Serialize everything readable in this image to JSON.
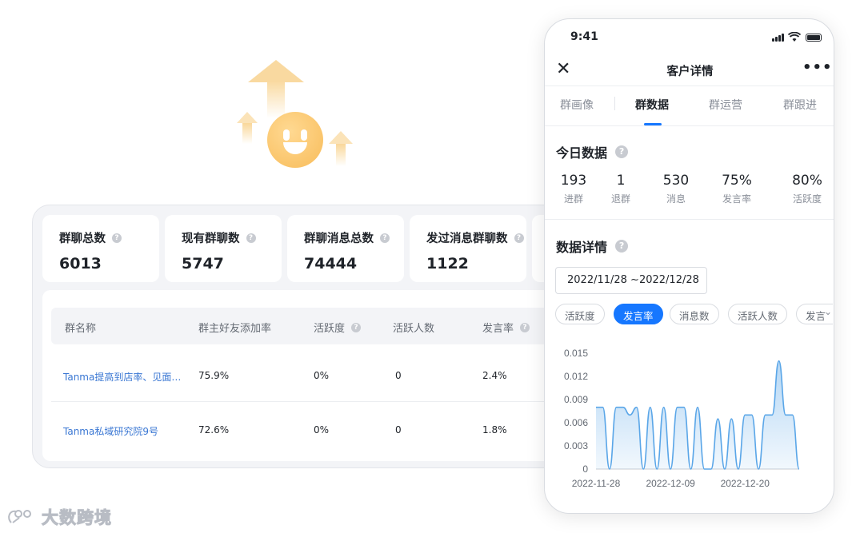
{
  "dashboard": {
    "stats": [
      {
        "label": "群聊总数",
        "value": "6013"
      },
      {
        "label": "现有群聊数",
        "value": "5747"
      },
      {
        "label": "群聊消息总数",
        "value": "74444"
      },
      {
        "label": "发过消息群聊数",
        "value": "1122"
      }
    ],
    "table": {
      "headers": [
        "群名称",
        "群主好友添加率",
        "活跃度",
        "活跃人数",
        "发言率"
      ],
      "rows": [
        [
          "Tanma提高到店率、见面…",
          "75.9%",
          "0%",
          "0",
          "2.4%"
        ],
        [
          "Tanma私域研究院9号",
          "72.6%",
          "0%",
          "0",
          "1.8%"
        ]
      ]
    }
  },
  "phone": {
    "status_time": "9:41",
    "title": "客户详情",
    "tabs": [
      "群画像",
      "群数据",
      "群运营",
      "群跟进"
    ],
    "active_tab": 1,
    "today_title": "今日数据",
    "kpis": [
      {
        "value": "193",
        "label": "进群"
      },
      {
        "value": "1",
        "label": "退群"
      },
      {
        "value": "530",
        "label": "消息"
      },
      {
        "value": "75%",
        "label": "发言率"
      },
      {
        "value": "80%",
        "label": "活跃度"
      }
    ],
    "detail_title": "数据详情",
    "date_range": "2022/11/28  ~2022/12/28",
    "chips": [
      "活跃度",
      "发言率",
      "消息数",
      "活跃人数",
      "发言"
    ],
    "active_chip": 1
  },
  "chart_data": {
    "type": "area",
    "y_ticks": [
      "0.015",
      "0.012",
      "0.009",
      "0.006",
      "0.003",
      "0"
    ],
    "ylim": [
      0,
      0.015
    ],
    "x_ticks": [
      "2022-11-28",
      "2022-12-09",
      "2022-12-20"
    ],
    "x": [
      "2022-11-28",
      "2022-11-29",
      "2022-11-30",
      "2022-12-01",
      "2022-12-02",
      "2022-12-03",
      "2022-12-04",
      "2022-12-05",
      "2022-12-06",
      "2022-12-07",
      "2022-12-08",
      "2022-12-09",
      "2022-12-10",
      "2022-12-11",
      "2022-12-12",
      "2022-12-13",
      "2022-12-14",
      "2022-12-15",
      "2022-12-16",
      "2022-12-17",
      "2022-12-18",
      "2022-12-19",
      "2022-12-20",
      "2022-12-21",
      "2022-12-22",
      "2022-12-23",
      "2022-12-24",
      "2022-12-25",
      "2022-12-26",
      "2022-12-27",
      "2022-12-28"
    ],
    "values": [
      0.008,
      0.008,
      0,
      0.008,
      0.008,
      0.007,
      0.008,
      0,
      0.008,
      0,
      0.008,
      0,
      0.008,
      0.008,
      0,
      0.008,
      0,
      0,
      0.0065,
      0,
      0.0065,
      0,
      0.007,
      0.007,
      0,
      0.007,
      0.007,
      0.014,
      0.007,
      0.007,
      0
    ],
    "color": "#5aa6e8"
  },
  "colors": {
    "accent": "#1677ff",
    "link": "#3a77d3"
  },
  "watermark": {
    "text": "大数跨境"
  }
}
